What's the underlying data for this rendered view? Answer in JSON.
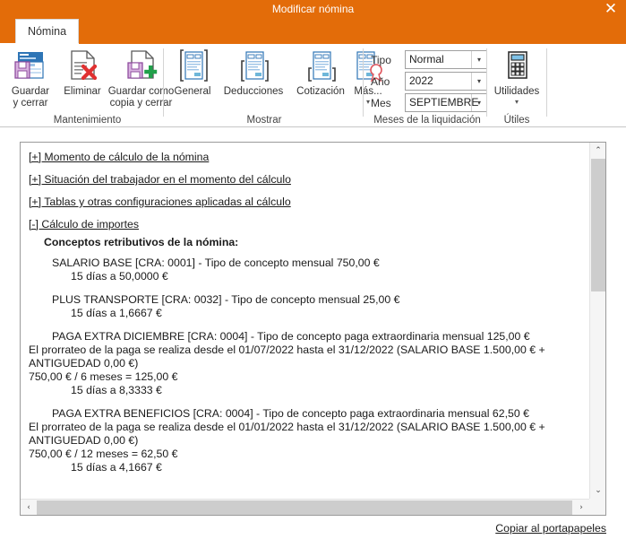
{
  "window": {
    "title": "Modificar nómina",
    "close_icon": "close-icon",
    "accent_color": "#e36c09"
  },
  "ribbon": {
    "tabs": [
      {
        "label": "Nómina",
        "active": true
      }
    ],
    "groups": [
      {
        "name": "Mantenimiento",
        "label": "Mantenimiento",
        "commands": [
          {
            "name": "guardar-y-cerrar",
            "label_line1": "Guardar",
            "label_line2": "y cerrar",
            "icon": "save-and-close-icon"
          },
          {
            "name": "eliminar",
            "label_line1": "Eliminar",
            "label_line2": "",
            "icon": "delete-document-icon"
          },
          {
            "name": "guardar-como-copia-y-cerrar",
            "label_line1": "Guardar como",
            "label_line2": "copia y cerrar",
            "icon": "save-as-copy-icon",
            "caret": "▾"
          }
        ]
      },
      {
        "name": "Mostrar",
        "label": "Mostrar",
        "commands": [
          {
            "name": "general",
            "label_line1": "General",
            "label_line2": "",
            "icon": "document-general-icon"
          },
          {
            "name": "deducciones",
            "label_line1": "Deducciones",
            "label_line2": "",
            "icon": "document-deductions-icon"
          },
          {
            "name": "cotizacion",
            "label_line1": "Cotización",
            "label_line2": "",
            "icon": "document-contribution-icon"
          },
          {
            "name": "mas",
            "label_line1": "Más...",
            "label_line2": "",
            "icon": "document-more-icon",
            "caret": "▾"
          }
        ]
      },
      {
        "name": "Meses de la liquidación",
        "label": "Meses de la liquidación",
        "fields": [
          {
            "name": "tipo",
            "label": "Tipo",
            "value": "Normal",
            "arrow": "▾"
          },
          {
            "name": "ano",
            "label": "Año",
            "value": "2022",
            "arrow": "▾"
          },
          {
            "name": "mes",
            "label": "Mes",
            "value": "SEPTIEMBRE",
            "arrow": "▾"
          }
        ]
      },
      {
        "name": "Útiles",
        "label": "Útiles",
        "commands": [
          {
            "name": "utilidades",
            "label_line1": "Utilidades",
            "label_line2": "",
            "icon": "calculator-icon",
            "caret": "▾"
          }
        ]
      }
    ]
  },
  "content": {
    "sections": [
      {
        "toggle": "[+]",
        "text": "[+] Momento de cálculo de la nómina"
      },
      {
        "toggle": "[+]",
        "text": "[+] Situación del trabajador en el momento del cálculo"
      },
      {
        "toggle": "[+]",
        "text": "[+] Tablas y otras configuraciones aplicadas al cálculo"
      },
      {
        "toggle": "[-]",
        "text": "[-] Cálculo de importes"
      }
    ],
    "section_title": "Conceptos retributivos de la nómina:",
    "concepts": [
      {
        "name": "salario-base",
        "lines": [
          {
            "indent": 1,
            "text": "SALARIO BASE [CRA: 0001] - Tipo de concepto mensual 750,00 €"
          },
          {
            "indent": 2,
            "text": "15 días a 50,0000 €"
          }
        ]
      },
      {
        "name": "plus-transporte",
        "lines": [
          {
            "indent": 1,
            "text": "PLUS TRANSPORTE [CRA: 0032] - Tipo de concepto mensual 25,00 €"
          },
          {
            "indent": 2,
            "text": "15 días a 1,6667 €"
          }
        ]
      },
      {
        "name": "paga-extra-diciembre",
        "lines": [
          {
            "indent": 1,
            "text": "PAGA EXTRA DICIEMBRE [CRA: 0004] - Tipo de concepto paga extraordinaria mensual 125,00 €"
          },
          {
            "indent": 0,
            "wrap": true,
            "text": "El prorrateo de la paga se realiza desde el 01/07/2022 hasta el 31/12/2022 (SALARIO BASE 1.500,00 € + ANTIGUEDAD 0,00 €)"
          },
          {
            "indent": 0,
            "text": "750,00 € / 6 meses = 125,00 €"
          },
          {
            "indent": 2,
            "text": "15 días a 8,3333 €"
          }
        ]
      },
      {
        "name": "paga-extra-beneficios",
        "lines": [
          {
            "indent": 1,
            "text": "PAGA EXTRA BENEFICIOS [CRA: 0004] - Tipo de concepto paga extraordinaria mensual 62,50 €"
          },
          {
            "indent": 0,
            "wrap": true,
            "text": "El prorrateo de la paga se realiza desde el 01/01/2022 hasta el 31/12/2022 (SALARIO BASE 1.500,00 € + ANTIGUEDAD 0,00 €)"
          },
          {
            "indent": 0,
            "text": "750,00 € / 12 meses = 62,50 €"
          },
          {
            "indent": 2,
            "text": "15 días a 4,1667 €"
          }
        ]
      }
    ]
  },
  "scrollbars": {
    "vertical": {
      "up_arrow": "⌃",
      "down_arrow": "⌄"
    },
    "horizontal": {
      "left_arrow": "‹",
      "right_arrow": "›"
    }
  },
  "footer": {
    "copy_link": "Copiar al portapapeles"
  }
}
